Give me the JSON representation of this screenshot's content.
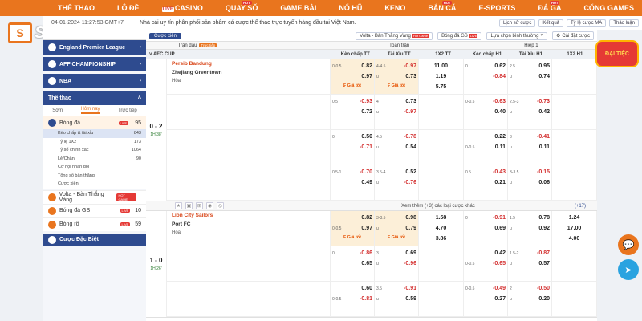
{
  "brand": {
    "mark": "S",
    "name": "SV88"
  },
  "nav": [
    "THỂ THAO",
    "LÔ ĐỀ",
    "CASINO",
    "QUAY SỐ",
    "GAME BÀI",
    "NỔ HŨ",
    "KENO",
    "BẮN CÁ",
    "E-SPORTS",
    "ĐÁ GÀ",
    "CỔNG GAMES"
  ],
  "nav_live": "LIVE",
  "hot_badge": "HOT",
  "info": {
    "datetime": "04-01-2024 11:27:53 GMT+7",
    "notice": "Nhà cái uy tín phân phối sản phẩm cá cược thể thao trực tuyến hàng đầu tại Việt Nam.",
    "pills": [
      "Lịch sử cược",
      "Kết quả",
      "Tỷ lệ cược MA",
      "Thảo luận"
    ]
  },
  "sidebar": {
    "leagues": [
      "England Premier League",
      "AFF CHAMPIONSHIP",
      "NBA"
    ],
    "sports_title": "Thể thao",
    "tabs": [
      "Sớm",
      "Hôm nay",
      "Trực tiếp"
    ],
    "football": {
      "label": "Bóng đá",
      "badge": "LIVE",
      "count": "95"
    },
    "rows": [
      {
        "label": "Kèo chấp & tài xỉu",
        "count": "843"
      },
      {
        "label": "Tỷ lệ 1X2",
        "count": "173"
      },
      {
        "label": "Tỷ số chính xác",
        "count": "1064"
      },
      {
        "label": "Lẻ/Chẵn",
        "count": "90"
      },
      {
        "label": "Cơ hội nhân đôi",
        "count": ""
      },
      {
        "label": "Tổng số bàn thắng",
        "count": ""
      },
      {
        "label": "Cược xiên",
        "count": ""
      }
    ],
    "items": [
      {
        "label": "Volta - Bàn Thắng Vàng",
        "badge": "HOT GAME",
        "count": ""
      },
      {
        "label": "Bóng đá GS",
        "badge": "LIVE",
        "count": "10"
      },
      {
        "label": "Bóng rổ",
        "badge": "LIVE",
        "count": "59"
      }
    ],
    "special": "Cược Đặc Biệt"
  },
  "toolbar": {
    "combo": "Cược xiên",
    "volta": "Volta - Bàn Thắng Vàng",
    "volta_badge": "Hot Game",
    "gs": "Bóng đá GS",
    "gs_badge": "LIVE",
    "sort": "Lựa chọn bình thường",
    "settings": "Cài đặt cược"
  },
  "header": {
    "left": "Trận đấu",
    "live": "Trực tiếp",
    "full": "Toàn trận",
    "half": "Hiệp 1"
  },
  "columns": [
    "Kèo chấp TT",
    "Tài Xỉu TT",
    "1X2 TT",
    "Kèo chấp H1",
    "Tài Xỉu H1",
    "1X2 H1"
  ],
  "league": "AFC CUP",
  "good_price": "Giá tốt",
  "draw_label": "Hòa",
  "more_bets": "Xem thêm (+3) các loại cược khác",
  "more_count": "(+17)",
  "matches": [
    {
      "score": "0 - 2",
      "time": "1H 38'",
      "home": "Persib Bandung",
      "away": "Zhejiang Greentown",
      "rows": [
        {
          "hc": [
            "0-0.5",
            "0.82",
            "",
            "0.97"
          ],
          "ou": [
            "4-4.5",
            "-0.97",
            "u",
            "0.73"
          ],
          "x": [
            "11.00",
            "1.19",
            "5.75"
          ],
          "hc1": [
            "0",
            "0.62",
            "",
            "-0.84"
          ],
          "ou1": [
            "2.5",
            "0.95",
            "u",
            "0.74"
          ],
          "x1": [
            "",
            "",
            ""
          ]
        },
        {
          "hc": [
            "0.5",
            "-0.93",
            "",
            "0.72"
          ],
          "ou": [
            "4",
            "0.73",
            "u",
            "-0.97"
          ],
          "x": [
            "",
            "",
            ""
          ],
          "hc1": [
            "0-0.5",
            "-0.63",
            "",
            "0.40"
          ],
          "ou1": [
            "2.5-3",
            "-0.73",
            "u",
            "0.42"
          ],
          "x1": [
            "",
            "",
            ""
          ]
        },
        {
          "hc": [
            "0",
            "0.50",
            "",
            "-0.71"
          ],
          "ou": [
            "4.5",
            "-0.78",
            "u",
            "0.54"
          ],
          "x": [
            "",
            "",
            ""
          ],
          "hc1": [
            "",
            "0.22",
            "0-0.5",
            "0.11"
          ],
          "ou1": [
            "3",
            "-0.41",
            "u",
            "0.11"
          ],
          "x1": [
            "",
            "",
            ""
          ]
        },
        {
          "hc": [
            "0.5-1",
            "-0.70",
            "",
            "0.49"
          ],
          "ou": [
            "3.5-4",
            "0.52",
            "u",
            "-0.76"
          ],
          "x": [
            "",
            "",
            ""
          ],
          "hc1": [
            "0.5",
            "-0.43",
            "",
            "0.21"
          ],
          "ou1": [
            "3-3.5",
            "-0.15",
            "u",
            "0.06"
          ],
          "x1": [
            "",
            "",
            ""
          ]
        }
      ]
    },
    {
      "score": "1 - 0",
      "time": "1H 26'",
      "home": "Lion City Sailors",
      "away": "Port FC",
      "rows": [
        {
          "hc": [
            "",
            "0.82",
            "0-0.5",
            "0.97"
          ],
          "ou": [
            "3-3.5",
            "0.98",
            "u",
            "0.79"
          ],
          "x": [
            "1.58",
            "4.70",
            "3.86"
          ],
          "hc1": [
            "0",
            "-0.91",
            "",
            "0.69"
          ],
          "ou1": [
            "1.5",
            "0.78",
            "u",
            "0.92"
          ],
          "x1": [
            "1.24",
            "17.00",
            "4.00"
          ]
        },
        {
          "hc": [
            "0",
            "-0.86",
            "",
            "0.65"
          ],
          "ou": [
            "3",
            "0.69",
            "u",
            "-0.96"
          ],
          "x": [
            "",
            "",
            ""
          ],
          "hc1": [
            "",
            "0.42",
            "0-0.5",
            "-0.65"
          ],
          "ou1": [
            "1.5-2",
            "-0.87",
            "u",
            "0.57"
          ],
          "x1": [
            "",
            "",
            ""
          ]
        },
        {
          "hc": [
            "",
            "0.60",
            "0-0.5",
            "-0.81"
          ],
          "ou": [
            "3.5",
            "-0.91",
            "u",
            "0.59"
          ],
          "x": [
            "",
            "",
            ""
          ],
          "hc1": [
            "0-0.5",
            "-0.49",
            "",
            "0.27"
          ],
          "ou1": [
            "2",
            "-0.50",
            "u",
            "0.20"
          ],
          "x1": [
            "",
            "",
            ""
          ]
        }
      ]
    }
  ],
  "promo": "ĐẠI TIỆC",
  "colors": {
    "orange": "#e9751e",
    "navy": "#2e4b8f",
    "red": "#d32f2f"
  }
}
